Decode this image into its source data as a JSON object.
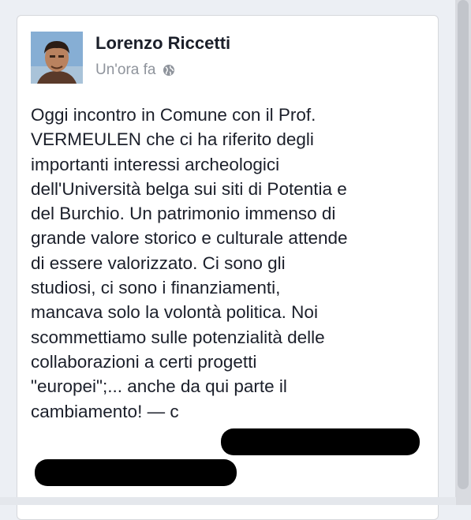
{
  "post": {
    "author_name": "Lorenzo Riccetti",
    "timestamp": "Un'ora fa",
    "privacy_icon": "globe-icon",
    "body_text": "Oggi incontro in Comune con il Prof.\nVERMEULEN che ci ha riferito degli\nimportanti interessi archeologici\ndell'Università belga sui siti di Potentia e\ndel Burchio. Un patrimonio immenso di\ngrande valore storico e culturale attende\ndi essere valorizzato.  Ci sono gli\nstudiosi, ci sono i finanziamenti,\nmancava solo la volontà politica. Noi\nscommettiamo sulle potenzialità delle\ncollaborazioni a certi progetti\n\"europei\";... anche da qui parte il\ncambiamento! — c"
  },
  "colors": {
    "card_bg": "#ffffff",
    "page_bg": "#eceff4",
    "author_text": "#1b1f2a",
    "meta_text": "#8f949c"
  }
}
